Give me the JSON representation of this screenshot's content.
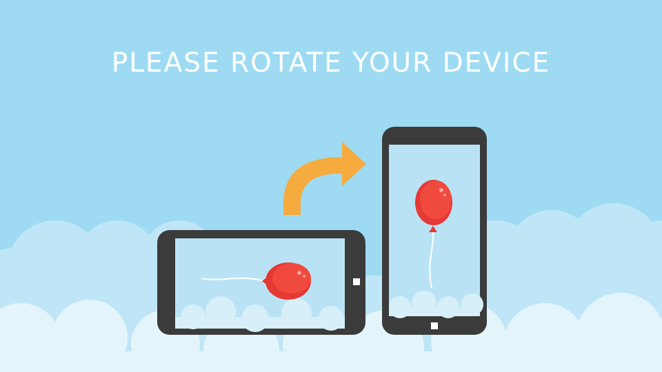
{
  "message": "PLEASE ROTATE YOUR DEVICE",
  "colors": {
    "sky": "#9edbf3",
    "cloud_back": "#bfe6f7",
    "cloud_front": "#e4f4fb",
    "phone_body": "#3b3b3b",
    "screen": "#b9e3f5",
    "arrow": "#f6ab3e",
    "balloon": "#e53935"
  },
  "icons": {
    "rotate_arrow": "rotate-arrow-icon",
    "landscape_phone": "landscape-phone-icon",
    "portrait_phone": "portrait-phone-icon",
    "balloon": "balloon-icon"
  }
}
